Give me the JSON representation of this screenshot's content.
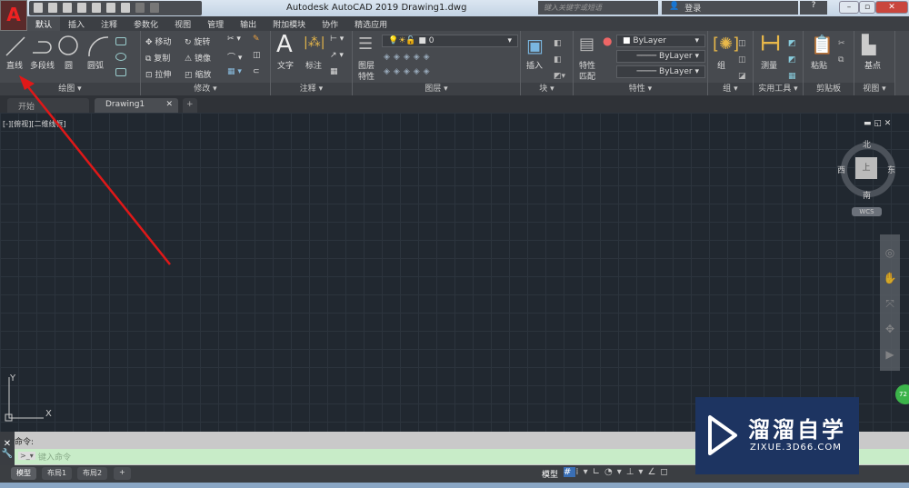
{
  "title": "Autodesk AutoCAD 2019    Drawing1.dwg",
  "search": {
    "placeholder": "键入关键字或短语"
  },
  "signin": "登录",
  "help": "?",
  "tabs": [
    "默认",
    "插入",
    "注释",
    "参数化",
    "视图",
    "管理",
    "输出",
    "附加模块",
    "协作",
    "精选应用"
  ],
  "ribbon": {
    "draw": {
      "label": "绘图",
      "line": "直线",
      "polyline": "多段线",
      "circle": "圆",
      "arc": "圆弧"
    },
    "modify": {
      "label": "修改",
      "move": "移动",
      "rotate": "旋转",
      "copy": "复制",
      "mirror": "镜像",
      "stretch": "拉伸",
      "scale": "缩放"
    },
    "annotation": {
      "label": "注释",
      "text": "文字",
      "dimension": "标注"
    },
    "layers": {
      "label": "图层",
      "props": "图层",
      "props2": "特性",
      "current": "0"
    },
    "block": {
      "label": "块",
      "insert": "插入"
    },
    "properties": {
      "label": "特性",
      "match": "特性",
      "match2": "匹配",
      "color": "ByLayer",
      "linetype": "ByLayer",
      "lineweight": "ByLayer"
    },
    "groups": {
      "label": "组",
      "group": "组"
    },
    "utilities": {
      "label": "实用工具",
      "measure": "测量"
    },
    "clipboard": {
      "label": "剪贴板",
      "paste": "粘贴"
    },
    "view": {
      "label": "视图",
      "base": "基点"
    }
  },
  "doc_tabs": [
    "开始",
    "Drawing1"
  ],
  "viewport_label": "[-][俯视][二维线框]",
  "viewcube": {
    "n": "北",
    "s": "南",
    "e": "东",
    "w": "西",
    "top": "上",
    "wcs": "WCS"
  },
  "ucs": {
    "x": "X",
    "y": "Y"
  },
  "command": {
    "history": "命令:",
    "placeholder": "键入命令"
  },
  "layout_tabs": [
    "模型",
    "布局1",
    "布局2"
  ],
  "status": {
    "model": "模型"
  },
  "watermark": {
    "name": "溜溜自学",
    "url": "ZIXUE.3D66.COM"
  },
  "badge": "72"
}
